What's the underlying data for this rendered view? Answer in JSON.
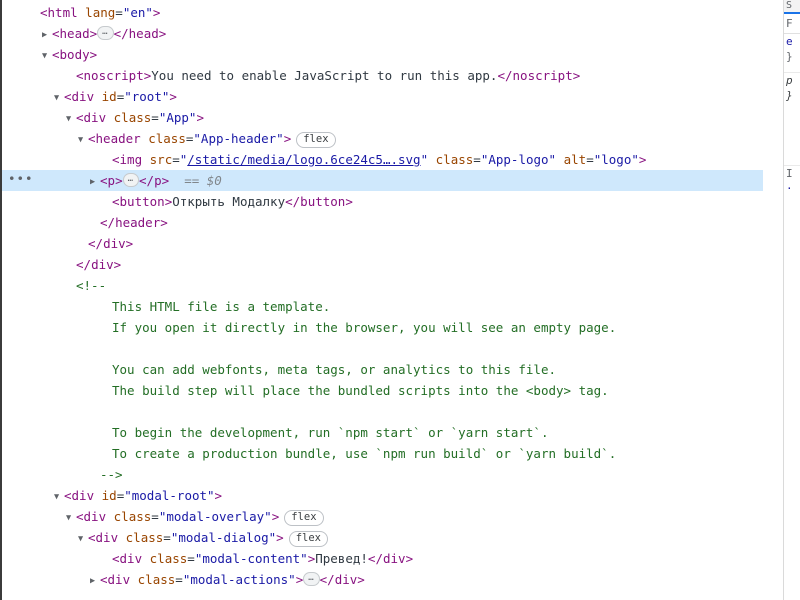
{
  "panel": {
    "name": "elements-panel",
    "selected_node": "<p>",
    "selected_ref": "== $0"
  },
  "colors": {
    "tag": "#881280",
    "attribute": "#994500",
    "value": "#1a1aa6",
    "comment": "#236e25",
    "text": "#303942",
    "selection_bg": "#cfe8fc",
    "accent": "#1a73e8",
    "scrollbar_thumb": "#c1c1c1"
  },
  "tree": [
    {
      "id": "line-html",
      "indent": 0,
      "triangle": "none",
      "segments": [
        {
          "cls": "punct",
          "t": "<"
        },
        {
          "cls": "tag",
          "t": "html"
        },
        {
          "cls": "text",
          "t": " "
        },
        {
          "cls": "attr",
          "t": "lang"
        },
        {
          "cls": "text",
          "t": "="
        },
        {
          "cls": "val",
          "t": "\"en\""
        },
        {
          "cls": "punct",
          "t": ">"
        }
      ]
    },
    {
      "id": "line-head",
      "indent": 1,
      "triangle": "closed",
      "segments": [
        {
          "cls": "punct",
          "t": "<"
        },
        {
          "cls": "tag",
          "t": "head"
        },
        {
          "cls": "punct",
          "t": ">"
        },
        {
          "cls": "ell",
          "t": "…"
        },
        {
          "cls": "punct",
          "t": "</"
        },
        {
          "cls": "tag",
          "t": "head"
        },
        {
          "cls": "punct",
          "t": ">"
        }
      ]
    },
    {
      "id": "line-body",
      "indent": 1,
      "triangle": "open",
      "segments": [
        {
          "cls": "punct",
          "t": "<"
        },
        {
          "cls": "tag",
          "t": "body"
        },
        {
          "cls": "punct",
          "t": ">"
        }
      ]
    },
    {
      "id": "line-noscript",
      "indent": 3,
      "triangle": "none",
      "segments": [
        {
          "cls": "punct",
          "t": "<"
        },
        {
          "cls": "tag",
          "t": "noscript"
        },
        {
          "cls": "punct",
          "t": ">"
        },
        {
          "cls": "text",
          "t": "You need to enable JavaScript to run this app."
        },
        {
          "cls": "punct",
          "t": "</"
        },
        {
          "cls": "tag",
          "t": "noscript"
        },
        {
          "cls": "punct",
          "t": ">"
        }
      ]
    },
    {
      "id": "line-div-root",
      "indent": 2,
      "triangle": "open",
      "segments": [
        {
          "cls": "punct",
          "t": "<"
        },
        {
          "cls": "tag",
          "t": "div"
        },
        {
          "cls": "text",
          "t": " "
        },
        {
          "cls": "attr",
          "t": "id"
        },
        {
          "cls": "text",
          "t": "="
        },
        {
          "cls": "val",
          "t": "\"root\""
        },
        {
          "cls": "punct",
          "t": ">"
        }
      ]
    },
    {
      "id": "line-div-app",
      "indent": 3,
      "triangle": "open",
      "segments": [
        {
          "cls": "punct",
          "t": "<"
        },
        {
          "cls": "tag",
          "t": "div"
        },
        {
          "cls": "text",
          "t": " "
        },
        {
          "cls": "attr",
          "t": "class"
        },
        {
          "cls": "text",
          "t": "="
        },
        {
          "cls": "val",
          "t": "\"App\""
        },
        {
          "cls": "punct",
          "t": ">"
        }
      ]
    },
    {
      "id": "line-header",
      "indent": 4,
      "triangle": "open",
      "segments": [
        {
          "cls": "punct",
          "t": "<"
        },
        {
          "cls": "tag",
          "t": "header"
        },
        {
          "cls": "text",
          "t": " "
        },
        {
          "cls": "attr",
          "t": "class"
        },
        {
          "cls": "text",
          "t": "="
        },
        {
          "cls": "val",
          "t": "\"App-header\""
        },
        {
          "cls": "punct",
          "t": ">"
        },
        {
          "cls": "flex",
          "t": "flex"
        }
      ]
    },
    {
      "id": "line-img-logo",
      "indent": 6,
      "triangle": "none",
      "segments": [
        {
          "cls": "punct",
          "t": "<"
        },
        {
          "cls": "tag",
          "t": "img"
        },
        {
          "cls": "text",
          "t": " "
        },
        {
          "cls": "attr",
          "t": "src"
        },
        {
          "cls": "text",
          "t": "="
        },
        {
          "cls": "val",
          "t": "\""
        },
        {
          "cls": "link",
          "t": "/static/media/logo.6ce24c5….svg"
        },
        {
          "cls": "val",
          "t": "\""
        },
        {
          "cls": "text",
          "t": " "
        },
        {
          "cls": "attr",
          "t": "class"
        },
        {
          "cls": "text",
          "t": "="
        },
        {
          "cls": "val",
          "t": "\"App-logo\""
        },
        {
          "cls": "text",
          "t": " "
        },
        {
          "cls": "attr",
          "t": "alt"
        },
        {
          "cls": "text",
          "t": "="
        },
        {
          "cls": "val",
          "t": "\"logo\""
        },
        {
          "cls": "punct",
          "t": ">"
        }
      ]
    },
    {
      "id": "line-p-selected",
      "indent": 5,
      "triangle": "closed",
      "selected": true,
      "dots": "•••",
      "segments": [
        {
          "cls": "punct",
          "t": "<"
        },
        {
          "cls": "tag",
          "t": "p"
        },
        {
          "cls": "punct",
          "t": ">"
        },
        {
          "cls": "ell",
          "t": "…"
        },
        {
          "cls": "punct",
          "t": "</"
        },
        {
          "cls": "tag",
          "t": "p"
        },
        {
          "cls": "punct",
          "t": ">"
        },
        {
          "cls": "dollar",
          "t": "  == $0"
        }
      ]
    },
    {
      "id": "line-button",
      "indent": 6,
      "triangle": "none",
      "segments": [
        {
          "cls": "punct",
          "t": "<"
        },
        {
          "cls": "tag",
          "t": "button"
        },
        {
          "cls": "punct",
          "t": ">"
        },
        {
          "cls": "text",
          "t": "Открыть Модалку"
        },
        {
          "cls": "punct",
          "t": "</"
        },
        {
          "cls": "tag",
          "t": "button"
        },
        {
          "cls": "punct",
          "t": ">"
        }
      ]
    },
    {
      "id": "line-close-header",
      "indent": 5,
      "triangle": "none",
      "segments": [
        {
          "cls": "punct",
          "t": "</"
        },
        {
          "cls": "tag",
          "t": "header"
        },
        {
          "cls": "punct",
          "t": ">"
        }
      ]
    },
    {
      "id": "line-close-div-app",
      "indent": 4,
      "triangle": "none",
      "segments": [
        {
          "cls": "punct",
          "t": "</"
        },
        {
          "cls": "tag",
          "t": "div"
        },
        {
          "cls": "punct",
          "t": ">"
        }
      ]
    },
    {
      "id": "line-close-div-root",
      "indent": 3,
      "triangle": "none",
      "segments": [
        {
          "cls": "punct",
          "t": "</"
        },
        {
          "cls": "tag",
          "t": "div"
        },
        {
          "cls": "punct",
          "t": ">"
        }
      ]
    },
    {
      "id": "line-comment-open",
      "indent": 3,
      "triangle": "none",
      "segments": [
        {
          "cls": "comment",
          "t": "<!--"
        }
      ]
    },
    {
      "id": "line-comment-1",
      "indent": 6,
      "triangle": "none",
      "segments": [
        {
          "cls": "comment",
          "t": "This HTML file is a template."
        }
      ]
    },
    {
      "id": "line-comment-2",
      "indent": 6,
      "triangle": "none",
      "segments": [
        {
          "cls": "comment",
          "t": "If you open it directly in the browser, you will see an empty page."
        }
      ]
    },
    {
      "id": "line-comment-blank-1",
      "indent": 6,
      "triangle": "none",
      "segments": [
        {
          "cls": "comment",
          "t": ""
        }
      ]
    },
    {
      "id": "line-comment-3",
      "indent": 6,
      "triangle": "none",
      "segments": [
        {
          "cls": "comment",
          "t": "You can add webfonts, meta tags, or analytics to this file."
        }
      ]
    },
    {
      "id": "line-comment-4",
      "indent": 6,
      "triangle": "none",
      "segments": [
        {
          "cls": "comment",
          "t": "The build step will place the bundled scripts into the <body> tag."
        }
      ]
    },
    {
      "id": "line-comment-blank-2",
      "indent": 6,
      "triangle": "none",
      "segments": [
        {
          "cls": "comment",
          "t": ""
        }
      ]
    },
    {
      "id": "line-comment-5",
      "indent": 6,
      "triangle": "none",
      "segments": [
        {
          "cls": "comment",
          "t": "To begin the development, run `npm start` or `yarn start`."
        }
      ]
    },
    {
      "id": "line-comment-6",
      "indent": 6,
      "triangle": "none",
      "segments": [
        {
          "cls": "comment",
          "t": "To create a production bundle, use `npm run build` or `yarn build`."
        }
      ]
    },
    {
      "id": "line-comment-close",
      "indent": 5,
      "triangle": "none",
      "segments": [
        {
          "cls": "comment",
          "t": "-->"
        }
      ]
    },
    {
      "id": "line-div-modal-root",
      "indent": 2,
      "triangle": "open",
      "segments": [
        {
          "cls": "punct",
          "t": "<"
        },
        {
          "cls": "tag",
          "t": "div"
        },
        {
          "cls": "text",
          "t": " "
        },
        {
          "cls": "attr",
          "t": "id"
        },
        {
          "cls": "text",
          "t": "="
        },
        {
          "cls": "val",
          "t": "\"modal-root\""
        },
        {
          "cls": "punct",
          "t": ">"
        }
      ]
    },
    {
      "id": "line-div-modal-overlay",
      "indent": 3,
      "triangle": "open",
      "segments": [
        {
          "cls": "punct",
          "t": "<"
        },
        {
          "cls": "tag",
          "t": "div"
        },
        {
          "cls": "text",
          "t": " "
        },
        {
          "cls": "attr",
          "t": "class"
        },
        {
          "cls": "text",
          "t": "="
        },
        {
          "cls": "val",
          "t": "\"modal-overlay\""
        },
        {
          "cls": "punct",
          "t": ">"
        },
        {
          "cls": "flex",
          "t": "flex"
        }
      ]
    },
    {
      "id": "line-div-modal-dialog",
      "indent": 4,
      "triangle": "open",
      "segments": [
        {
          "cls": "punct",
          "t": "<"
        },
        {
          "cls": "tag",
          "t": "div"
        },
        {
          "cls": "text",
          "t": " "
        },
        {
          "cls": "attr",
          "t": "class"
        },
        {
          "cls": "text",
          "t": "="
        },
        {
          "cls": "val",
          "t": "\"modal-dialog\""
        },
        {
          "cls": "punct",
          "t": ">"
        },
        {
          "cls": "flex",
          "t": "flex"
        }
      ]
    },
    {
      "id": "line-div-modal-content",
      "indent": 6,
      "triangle": "none",
      "segments": [
        {
          "cls": "punct",
          "t": "<"
        },
        {
          "cls": "tag",
          "t": "div"
        },
        {
          "cls": "text",
          "t": " "
        },
        {
          "cls": "attr",
          "t": "class"
        },
        {
          "cls": "text",
          "t": "="
        },
        {
          "cls": "val",
          "t": "\"modal-content\""
        },
        {
          "cls": "punct",
          "t": ">"
        },
        {
          "cls": "text",
          "t": "Превед!"
        },
        {
          "cls": "punct",
          "t": "</"
        },
        {
          "cls": "tag",
          "t": "div"
        },
        {
          "cls": "punct",
          "t": ">"
        }
      ]
    },
    {
      "id": "line-div-modal-actions",
      "indent": 5,
      "triangle": "closed",
      "segments": [
        {
          "cls": "punct",
          "t": "<"
        },
        {
          "cls": "tag",
          "t": "div"
        },
        {
          "cls": "text",
          "t": " "
        },
        {
          "cls": "attr",
          "t": "class"
        },
        {
          "cls": "text",
          "t": "="
        },
        {
          "cls": "val",
          "t": "\"modal-actions\""
        },
        {
          "cls": "punct",
          "t": ">"
        },
        {
          "cls": "ell",
          "t": "…"
        },
        {
          "cls": "punct",
          "t": "</"
        },
        {
          "cls": "tag",
          "t": "div"
        },
        {
          "cls": "punct",
          "t": ">"
        }
      ]
    }
  ],
  "scrollbar": {
    "up_arrow": "scroll-up-arrow",
    "thumb": "scroll-thumb"
  },
  "styles_pane": {
    "tab_label": "S",
    "filter_placeholder": "F",
    "lines": [
      {
        "t": "e",
        "cls": "css-prop"
      },
      {
        "t": "}",
        "cls": "css-gray"
      },
      {
        "t": "p",
        "cls": "css-ital"
      },
      {
        "t": "}",
        "cls": "css-ital"
      },
      {
        "t": "I",
        "cls": "css-gray"
      },
      {
        "t": "·",
        "cls": "css-prop"
      }
    ]
  }
}
